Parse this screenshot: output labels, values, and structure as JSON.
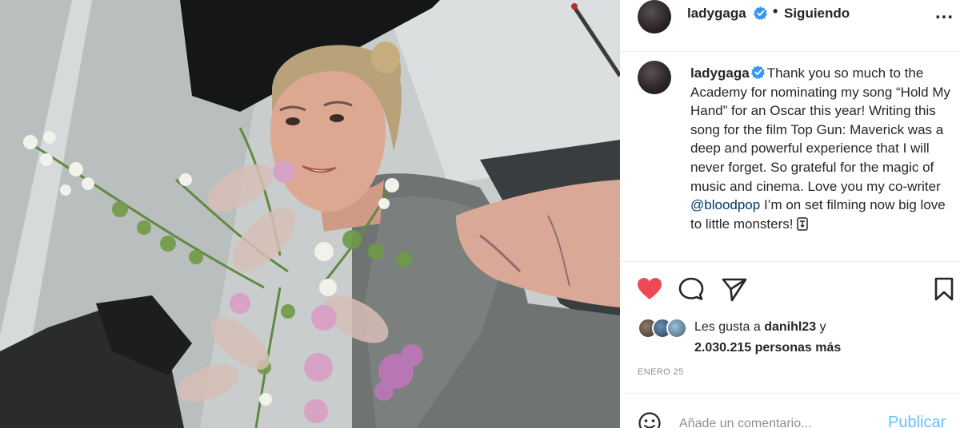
{
  "post": {
    "username": "ladygaga",
    "follow_status": "Siguiendo",
    "more_label": "...",
    "caption": {
      "username": "ladygaga",
      "text_before_mention": "Thank you so much to the Academy for nominating my song “Hold My Hand” for an Oscar this year! Writing this song for the film Top Gun: Maverick was a deep and powerful experience that I will never forget. So grateful for the magic of music and cinema. Love you my co-writer",
      "mention": "@bloodpop",
      "text_after_mention": "I’m on set filming now big love to little monsters!"
    },
    "likes": {
      "prefix": "Les gusta a",
      "user": "danihl23",
      "joiner": "y",
      "others": "2.030.215 personas más"
    },
    "date": "ENERO 25",
    "comment": {
      "placeholder": "Añade un comentario...",
      "publish_label": "Publicar"
    }
  },
  "icons": {
    "verified": "verified-badge-icon",
    "like": "heart-icon",
    "comment": "comment-bubble-icon",
    "share": "send-icon",
    "save": "bookmark-icon",
    "emoji": "emoji-icon",
    "pointer": "pointing-hand-icon"
  },
  "colors": {
    "like_red": "#ed4956",
    "verified_blue": "#3897f0",
    "link_blue": "#0095f6",
    "mention_blue": "#00376b",
    "muted_gray": "#8e8e8e"
  }
}
